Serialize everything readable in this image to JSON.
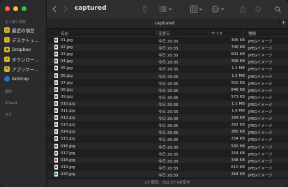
{
  "window": {
    "title": "captured"
  },
  "sidebar": {
    "favorites_label": "よく使う項目",
    "favorites": [
      {
        "label": "最近の項目",
        "icon": "recents-icon"
      },
      {
        "label": "デスクトッ…",
        "icon": "desktop-folder-icon"
      },
      {
        "label": "Dropbox",
        "icon": "dropbox-icon"
      },
      {
        "label": "ダウンロー…",
        "icon": "downloads-folder-icon"
      },
      {
        "label": "アプリケー…",
        "icon": "applications-icon"
      },
      {
        "label": "AirDrop",
        "icon": "airdrop-icon"
      }
    ],
    "locations_label": "場所",
    "icloud_label": "iCloud",
    "tags_label": "タグ"
  },
  "tab": {
    "label": "captured"
  },
  "columns": {
    "name": "名前",
    "date": "変更日",
    "size": "サイズ",
    "kind": "種類"
  },
  "files": [
    {
      "name": "01.jpg",
      "date": "今日 20:35",
      "size": "306 KB",
      "kind": "JPEGイメージ"
    },
    {
      "name": "02.jpg",
      "date": "今日 20:35",
      "size": "746 KB",
      "kind": "JPEGイメージ"
    },
    {
      "name": "03.jpg",
      "date": "今日 20:35",
      "size": "691 KB",
      "kind": "JPEGイメージ"
    },
    {
      "name": "04.jpg",
      "date": "今日 20:35",
      "size": "398 KB",
      "kind": "JPEGイメージ"
    },
    {
      "name": "05.jpg",
      "date": "今日 20:35",
      "size": "1.2 MB",
      "kind": "JPEGイメージ"
    },
    {
      "name": "06.jpg",
      "date": "今日 20:35",
      "size": "1.5 MB",
      "kind": "JPEGイメージ"
    },
    {
      "name": "07.jpg",
      "date": "今日 20:35",
      "size": "550 KB",
      "kind": "JPEGイメージ"
    },
    {
      "name": "08.jpg",
      "date": "今日 20:35",
      "size": "846 KB",
      "kind": "JPEGイメージ"
    },
    {
      "name": "09.jpg",
      "date": "今日 20:35",
      "size": "573 KB",
      "kind": "JPEGイメージ"
    },
    {
      "name": "010.jpg",
      "date": "今日 20:35",
      "size": "1.1 MB",
      "kind": "JPEGイメージ"
    },
    {
      "name": "011.jpg",
      "date": "今日 20:35",
      "size": "1.6 MB",
      "kind": "JPEGイメージ"
    },
    {
      "name": "012.jpg",
      "date": "今日 20:35",
      "size": "199 KB",
      "kind": "JPEGイメージ"
    },
    {
      "name": "013.jpg",
      "date": "今日 20:35",
      "size": "282 KB",
      "kind": "JPEGイメージ"
    },
    {
      "name": "014.jpg",
      "date": "今日 20:35",
      "size": "385 KB",
      "kind": "JPEGイメージ"
    },
    {
      "name": "015.jpg",
      "date": "今日 20:35",
      "size": "254 KB",
      "kind": "JPEGイメージ"
    },
    {
      "name": "016.jpg",
      "date": "今日 20:35",
      "size": "530 KB",
      "kind": "JPEGイメージ"
    },
    {
      "name": "017.jpg",
      "date": "今日 20:35",
      "size": "254 KB",
      "kind": "JPEGイメージ"
    },
    {
      "name": "018.jpg",
      "date": "今日 20:35",
      "size": "348 KB",
      "kind": "JPEGイメージ"
    },
    {
      "name": "019.jpg",
      "date": "今日 20:35",
      "size": "610 KB",
      "kind": "JPEGイメージ"
    },
    {
      "name": "020.jpg",
      "date": "今日 20:35",
      "size": "264 KB",
      "kind": "JPEGイメージ"
    }
  ],
  "status": {
    "text": "23 項目、322.27 GB空き"
  },
  "colors": {
    "accent": "#d9b52a",
    "close": "#ff5f57",
    "minimize": "#febc2e",
    "zoom": "#28c840"
  }
}
